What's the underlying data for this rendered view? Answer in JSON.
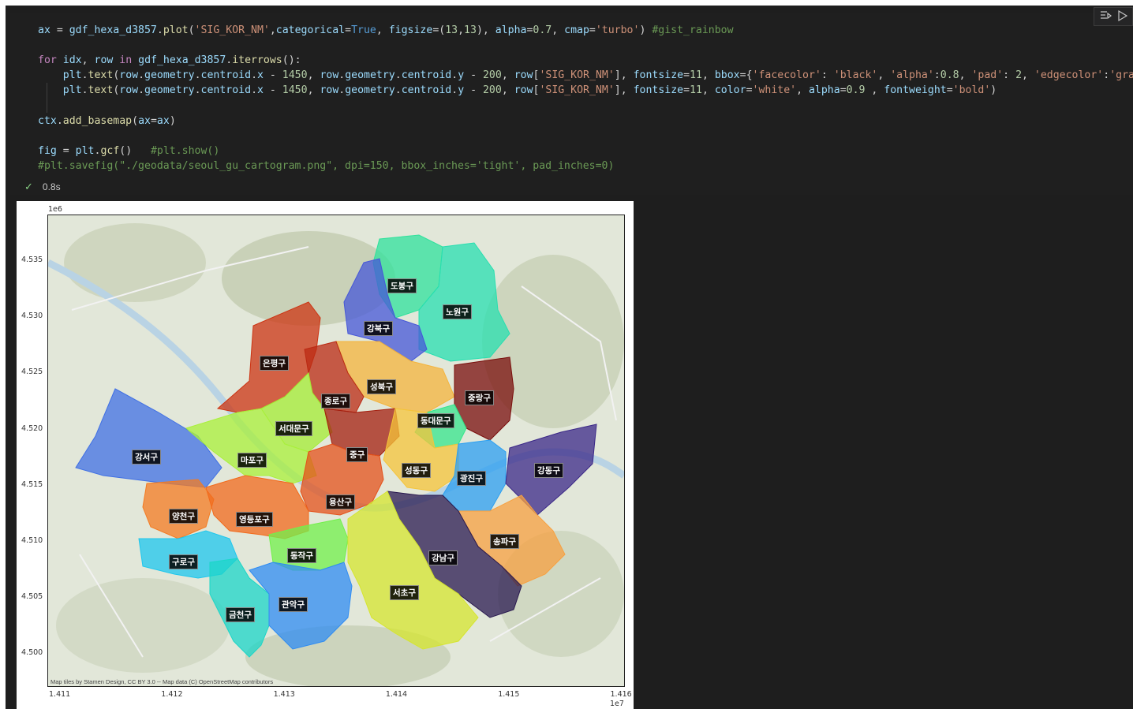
{
  "colors": {
    "editor_bg": "#1f1f1f",
    "success": "#89d185"
  },
  "code": {
    "lines": [
      [
        [
          "va",
          "ax"
        ],
        [
          "op",
          " = "
        ],
        [
          "va",
          "gdf_hexa_d3857"
        ],
        [
          "op",
          "."
        ],
        [
          "fn",
          "plot"
        ],
        [
          "op",
          "("
        ],
        [
          "st",
          "'SIG_KOR_NM'"
        ],
        [
          "op",
          ","
        ],
        [
          "va",
          "categorical"
        ],
        [
          "op",
          "="
        ],
        [
          "kwb",
          "True"
        ],
        [
          "op",
          ", "
        ],
        [
          "va",
          "figsize"
        ],
        [
          "op",
          "=("
        ],
        [
          "nm",
          "13"
        ],
        [
          "op",
          ","
        ],
        [
          "nm",
          "13"
        ],
        [
          "op",
          "), "
        ],
        [
          "va",
          "alpha"
        ],
        [
          "op",
          "="
        ],
        [
          "nm",
          "0.7"
        ],
        [
          "op",
          ", "
        ],
        [
          "va",
          "cmap"
        ],
        [
          "op",
          "="
        ],
        [
          "st",
          "'turbo'"
        ],
        [
          "op",
          ") "
        ],
        [
          "cm",
          "#gist_rainbow"
        ]
      ],
      [],
      [
        [
          "kw",
          "for"
        ],
        [
          "op",
          " "
        ],
        [
          "va",
          "idx"
        ],
        [
          "op",
          ", "
        ],
        [
          "va",
          "row"
        ],
        [
          "op",
          " "
        ],
        [
          "kw",
          "in"
        ],
        [
          "op",
          " "
        ],
        [
          "va",
          "gdf_hexa_d3857"
        ],
        [
          "op",
          "."
        ],
        [
          "fn",
          "iterrows"
        ],
        [
          "op",
          "():"
        ]
      ],
      [
        [
          "op",
          "    "
        ],
        [
          "va",
          "plt"
        ],
        [
          "op",
          "."
        ],
        [
          "fn",
          "text"
        ],
        [
          "op",
          "("
        ],
        [
          "va",
          "row"
        ],
        [
          "op",
          "."
        ],
        [
          "va",
          "geometry"
        ],
        [
          "op",
          "."
        ],
        [
          "va",
          "centroid"
        ],
        [
          "op",
          "."
        ],
        [
          "va",
          "x"
        ],
        [
          "op",
          " - "
        ],
        [
          "nm",
          "1450"
        ],
        [
          "op",
          ", "
        ],
        [
          "va",
          "row"
        ],
        [
          "op",
          "."
        ],
        [
          "va",
          "geometry"
        ],
        [
          "op",
          "."
        ],
        [
          "va",
          "centroid"
        ],
        [
          "op",
          "."
        ],
        [
          "va",
          "y"
        ],
        [
          "op",
          " - "
        ],
        [
          "nm",
          "200"
        ],
        [
          "op",
          ", "
        ],
        [
          "va",
          "row"
        ],
        [
          "op",
          "["
        ],
        [
          "st",
          "'SIG_KOR_NM'"
        ],
        [
          "op",
          "], "
        ],
        [
          "va",
          "fontsize"
        ],
        [
          "op",
          "="
        ],
        [
          "nm",
          "11"
        ],
        [
          "op",
          ", "
        ],
        [
          "va",
          "bbox"
        ],
        [
          "op",
          "={"
        ],
        [
          "st",
          "'facecolor'"
        ],
        [
          "op",
          ": "
        ],
        [
          "st",
          "'black'"
        ],
        [
          "op",
          ", "
        ],
        [
          "st",
          "'alpha'"
        ],
        [
          "op",
          ":"
        ],
        [
          "nm",
          "0.8"
        ],
        [
          "op",
          ", "
        ],
        [
          "st",
          "'pad'"
        ],
        [
          "op",
          ": "
        ],
        [
          "nm",
          "2"
        ],
        [
          "op",
          ", "
        ],
        [
          "st",
          "'edgecolor'"
        ],
        [
          "op",
          ":"
        ],
        [
          "st",
          "'gray'"
        ],
        [
          "op",
          "})"
        ]
      ],
      [
        [
          "op",
          "    "
        ],
        [
          "va",
          "plt"
        ],
        [
          "op",
          "."
        ],
        [
          "fn",
          "text"
        ],
        [
          "op",
          "("
        ],
        [
          "va",
          "row"
        ],
        [
          "op",
          "."
        ],
        [
          "va",
          "geometry"
        ],
        [
          "op",
          "."
        ],
        [
          "va",
          "centroid"
        ],
        [
          "op",
          "."
        ],
        [
          "va",
          "x"
        ],
        [
          "op",
          " - "
        ],
        [
          "nm",
          "1450"
        ],
        [
          "op",
          ", "
        ],
        [
          "va",
          "row"
        ],
        [
          "op",
          "."
        ],
        [
          "va",
          "geometry"
        ],
        [
          "op",
          "."
        ],
        [
          "va",
          "centroid"
        ],
        [
          "op",
          "."
        ],
        [
          "va",
          "y"
        ],
        [
          "op",
          " - "
        ],
        [
          "nm",
          "200"
        ],
        [
          "op",
          ", "
        ],
        [
          "va",
          "row"
        ],
        [
          "op",
          "["
        ],
        [
          "st",
          "'SIG_KOR_NM'"
        ],
        [
          "op",
          "], "
        ],
        [
          "va",
          "fontsize"
        ],
        [
          "op",
          "="
        ],
        [
          "nm",
          "11"
        ],
        [
          "op",
          ", "
        ],
        [
          "va",
          "color"
        ],
        [
          "op",
          "="
        ],
        [
          "st",
          "'white'"
        ],
        [
          "op",
          ", "
        ],
        [
          "va",
          "alpha"
        ],
        [
          "op",
          "="
        ],
        [
          "nm",
          "0.9"
        ],
        [
          "op",
          " , "
        ],
        [
          "va",
          "fontweight"
        ],
        [
          "op",
          "="
        ],
        [
          "st",
          "'bold'"
        ],
        [
          "op",
          ")"
        ]
      ],
      [],
      [
        [
          "va",
          "ctx"
        ],
        [
          "op",
          "."
        ],
        [
          "fn",
          "add_basemap"
        ],
        [
          "op",
          "("
        ],
        [
          "va",
          "ax"
        ],
        [
          "op",
          "="
        ],
        [
          "va",
          "ax"
        ],
        [
          "op",
          ")"
        ]
      ],
      [],
      [
        [
          "va",
          "fig"
        ],
        [
          "op",
          " = "
        ],
        [
          "va",
          "plt"
        ],
        [
          "op",
          "."
        ],
        [
          "fn",
          "gcf"
        ],
        [
          "op",
          "()   "
        ],
        [
          "cm",
          "#plt.show()"
        ]
      ],
      [
        [
          "cm",
          "#plt.savefig(\"./geodata/seoul_gu_cartogram.png\", dpi=150, bbox_inches='tight', pad_inches=0)"
        ]
      ]
    ]
  },
  "status": {
    "check": "✓",
    "time": "0.8s"
  },
  "plot": {
    "y_multiplier": "1e6",
    "x_multiplier": "1e7",
    "y_ticks": [
      "4.535",
      "4.530",
      "4.525",
      "4.520",
      "4.515",
      "4.510",
      "4.505",
      "4.500"
    ],
    "x_ticks": [
      "1.411",
      "1.412",
      "1.413",
      "1.414",
      "1.415",
      "1.416"
    ],
    "attribution": "Map tiles by Stamen Design, CC BY 3.0 -- Map data (C) OpenStreetMap contributors",
    "districts": [
      {
        "name": "도봉구",
        "color": "#2fe29c"
      },
      {
        "name": "노원구",
        "color": "#27dfb0"
      },
      {
        "name": "강북구",
        "color": "#4657d8"
      },
      {
        "name": "은평구",
        "color": "#cc3413"
      },
      {
        "name": "성북구",
        "color": "#f4b43c"
      },
      {
        "name": "중랑구",
        "color": "#7a0e0c"
      },
      {
        "name": "종로구",
        "color": "#bb2a13"
      },
      {
        "name": "동대문구",
        "color": "#35e68c"
      },
      {
        "name": "서대문구",
        "color": "#a4ec34"
      },
      {
        "name": "강서구",
        "color": "#4070e4"
      },
      {
        "name": "마포구",
        "color": "#a9f03a"
      },
      {
        "name": "중구",
        "color": "#a41f0f"
      },
      {
        "name": "성동구",
        "color": "#f5c43a"
      },
      {
        "name": "광진구",
        "color": "#2c9ff2"
      },
      {
        "name": "강동구",
        "color": "#3b2888"
      },
      {
        "name": "용산구",
        "color": "#e4521b"
      },
      {
        "name": "양천구",
        "color": "#f47b22"
      },
      {
        "name": "영등포구",
        "color": "#f26a1c"
      },
      {
        "name": "송파구",
        "color": "#f7a040"
      },
      {
        "name": "구로구",
        "color": "#1ec7ed"
      },
      {
        "name": "동작구",
        "color": "#72f04b"
      },
      {
        "name": "강남구",
        "color": "#2a1a50"
      },
      {
        "name": "서초구",
        "color": "#d6e52f"
      },
      {
        "name": "금천구",
        "color": "#1bd6c8"
      },
      {
        "name": "관악구",
        "color": "#2f8cf3"
      }
    ]
  }
}
